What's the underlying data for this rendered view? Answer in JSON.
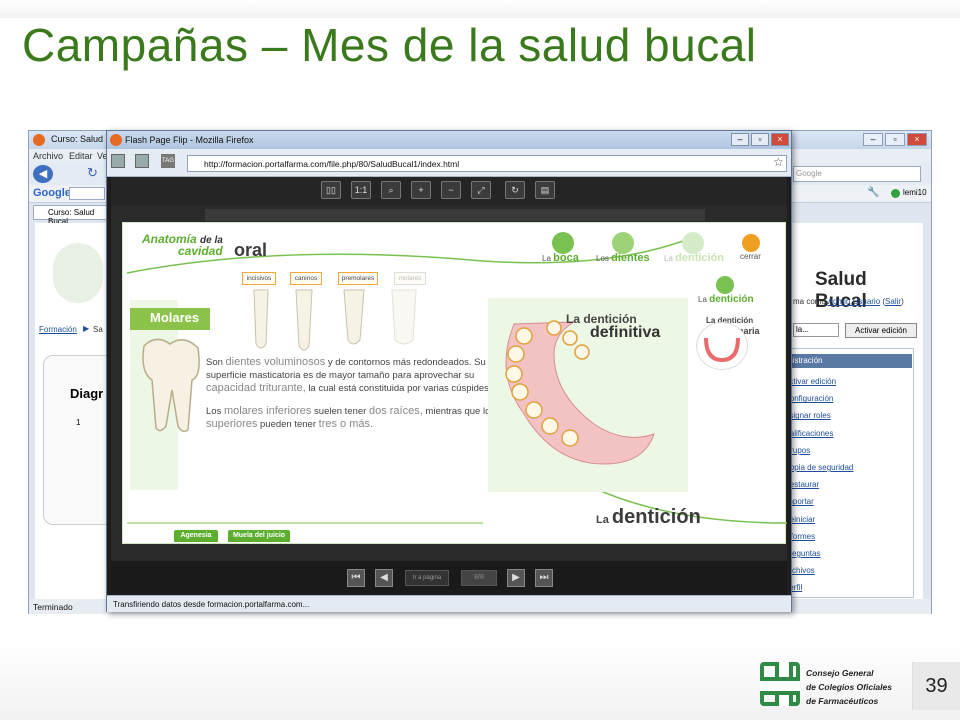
{
  "slide": {
    "title": "Campañas – Mes de la salud bucal",
    "page_number": "39",
    "cofm": {
      "line1": "Consejo General",
      "line2": "de Colegios Oficiales",
      "line3": "de Farmacéuticos"
    }
  },
  "bg_browser": {
    "tab_title": "Curso: Salud Bucal",
    "menu": [
      "Archivo",
      "Editar",
      "Ve"
    ],
    "google": "Google",
    "search_placeholder": "Google",
    "user": "lemi10",
    "course_title": "Salud Bucal",
    "user_line_prefix": "ma como",
    "user_name": "Admin Usuario",
    "logout": "Salir",
    "breadcrumb_home": "Formación",
    "breadcrumb_sep": "▶",
    "breadcrumb_next": "Sa",
    "diag": "Diagr",
    "list_num": "1",
    "activate_edit": "Activar edición",
    "dropdown_tail": "la...",
    "admin_header": "Administración",
    "admin_items": [
      {
        "label": "Activar edición",
        "color": "#4a7dbf"
      },
      {
        "label": "Configuración",
        "color": "#5b8fd0"
      },
      {
        "label": "Asignar roles",
        "color": "#7aa6d8"
      },
      {
        "label": "Calificaciones",
        "color": "#6fb04a"
      },
      {
        "label": "Grupos",
        "color": "#3f86c9"
      },
      {
        "label": "Copia de seguridad",
        "color": "#4f7fb8"
      },
      {
        "label": "Restaurar",
        "color": "#5d87bd"
      },
      {
        "label": "Importar",
        "color": "#d6a53a"
      },
      {
        "label": "Reiniciar",
        "color": "#5aa84a"
      },
      {
        "label": "Informes",
        "color": "#7d8ea6"
      },
      {
        "label": "Preguntas",
        "color": "#8b8b8b"
      },
      {
        "label": "Archivos",
        "color": "#e0b33a"
      },
      {
        "label": "Perfil",
        "color": "#6b8fc0"
      }
    ],
    "status": "Terminado"
  },
  "flash_window": {
    "title": "Flash Page Flip - Mozilla Firefox",
    "url": "http://formacion.portalfarma.com/file.php/80/SaludBucal1/index.html",
    "status": "Transfiriendo datos desde formacion.portalfarma.com...",
    "toolbar": [
      "1:1"
    ],
    "page_input": "Ir a página",
    "page_count": "8/8"
  },
  "page": {
    "anatomia": "Anatomía",
    "de_la": "de la",
    "cavidad": "cavidad",
    "oral": "oral",
    "tooth_tabs": [
      "incisivos",
      "caninos",
      "premolares",
      "molares"
    ],
    "nav": {
      "la_boca_1": "La",
      "la_boca_2": "boca",
      "los_dientes_1": "Los",
      "los_dientes_2": "dientes",
      "la_denticion_1": "La",
      "la_denticion_2": "dentición",
      "cerrar": "cerrar"
    },
    "molares_title": "Molares",
    "para1_a": "Son",
    "para1_b": "dientes voluminosos",
    "para1_c": "y de contornos más redondeados. Su superficie masticatoria es de mayor tamaño para aprovechar su",
    "para1_d": "capacidad triturante,",
    "para1_e": "la cual está constituida por varias cúspides.",
    "para2_a": "Los",
    "para2_b": "molares inferiores",
    "para2_c": "suelen tener",
    "para2_d": "dos raíces,",
    "para2_e": "mientras que los",
    "para2_f": "superiores",
    "para2_g": "pueden tener",
    "para2_h": "tres o más.",
    "def_1": "La dentición",
    "def_2": "definitiva",
    "side_1": "La",
    "side_2": "dentición",
    "prim_1": "La dentición",
    "prim_2": "primaria",
    "footer_1": "La",
    "footer_2": "dentición",
    "bottom_tabs": [
      "Agenesia",
      "Muela del juicio"
    ]
  }
}
